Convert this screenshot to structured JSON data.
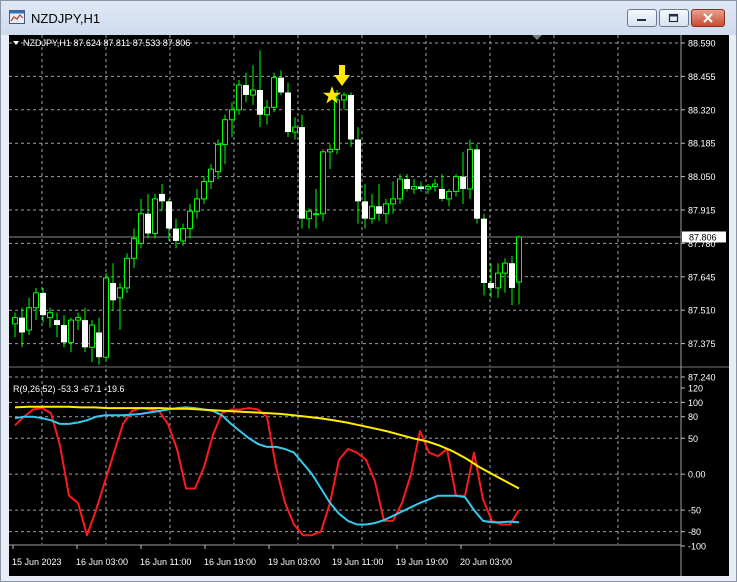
{
  "window": {
    "title": "NZDJPY,H1",
    "icons": {
      "app": "chart-window-icon",
      "minimize": "minimize-icon",
      "maximize": "maximize-icon",
      "close": "close-icon"
    }
  },
  "main_chart": {
    "header": "NZDJPY,H1  87.624 87.811 87.533 87.806",
    "price_ticks": [
      "88.590",
      "88.455",
      "88.320",
      "88.185",
      "88.050",
      "87.915",
      "87.780",
      "87.645",
      "87.510",
      "87.375",
      "87.240"
    ],
    "current_price_label": "87.806",
    "current_price": 87.806,
    "markers": {
      "star": "star-icon",
      "arrow": "arrow-down-icon"
    }
  },
  "indicator": {
    "header": "R(9,26,52) -53.3 -67.1 -19.6",
    "ticks": [
      "120",
      "100",
      "80",
      "50",
      "0.00",
      "-50",
      "-80",
      "-100"
    ]
  },
  "time_axis": {
    "labels": [
      "15 Jun 2023",
      "16 Jun 03:00",
      "16 Jun 11:00",
      "16 Jun 19:00",
      "19 Jun 03:00",
      "19 Jun 11:00",
      "19 Jun 19:00",
      "20 Jun 03:00"
    ]
  },
  "colors": {
    "candle": "#00ff00",
    "fast_line": "#ff1a1a",
    "mid_line": "#33ccee",
    "slow_line": "#ffee00",
    "marker": "#ffe800",
    "grid": "#9aa0a8"
  },
  "chart_data": {
    "type": "candlestick",
    "symbol": "NZDJPY",
    "timeframe": "H1",
    "ylim": [
      87.24,
      88.59
    ],
    "candles": [
      [
        87.455,
        87.5,
        87.4,
        87.48
      ],
      [
        87.48,
        87.52,
        87.36,
        87.42
      ],
      [
        87.43,
        87.56,
        87.41,
        87.52
      ],
      [
        87.52,
        87.6,
        87.47,
        87.58
      ],
      [
        87.58,
        87.6,
        87.46,
        87.49
      ],
      [
        87.48,
        87.52,
        87.44,
        87.5
      ],
      [
        87.47,
        87.5,
        87.4,
        87.45
      ],
      [
        87.45,
        87.49,
        87.36,
        87.38
      ],
      [
        87.38,
        87.48,
        87.34,
        87.47
      ],
      [
        87.47,
        87.5,
        87.43,
        87.48
      ],
      [
        87.47,
        87.52,
        87.34,
        87.36
      ],
      [
        87.36,
        87.47,
        87.3,
        87.45
      ],
      [
        87.42,
        87.48,
        87.29,
        87.32
      ],
      [
        87.32,
        87.66,
        87.3,
        87.64
      ],
      [
        87.62,
        87.7,
        87.51,
        87.55
      ],
      [
        87.56,
        87.62,
        87.43,
        87.6
      ],
      [
        87.6,
        87.74,
        87.58,
        87.72
      ],
      [
        87.72,
        87.84,
        87.68,
        87.8
      ],
      [
        87.78,
        87.96,
        87.76,
        87.9
      ],
      [
        87.9,
        87.98,
        87.8,
        87.82
      ],
      [
        87.82,
        87.98,
        87.8,
        87.96
      ],
      [
        87.98,
        88.02,
        87.91,
        87.95
      ],
      [
        87.95,
        87.96,
        87.79,
        87.84
      ],
      [
        87.84,
        87.88,
        87.76,
        87.79
      ],
      [
        87.79,
        87.86,
        87.77,
        87.84
      ],
      [
        87.84,
        87.94,
        87.8,
        87.91
      ],
      [
        87.91,
        88.0,
        87.88,
        87.96
      ],
      [
        87.96,
        88.05,
        87.94,
        88.03
      ],
      [
        88.03,
        88.1,
        88.0,
        88.08
      ],
      [
        88.07,
        88.2,
        88.04,
        88.18
      ],
      [
        88.18,
        88.3,
        88.1,
        88.28
      ],
      [
        88.28,
        88.35,
        88.21,
        88.32
      ],
      [
        88.32,
        88.44,
        88.3,
        88.42
      ],
      [
        88.42,
        88.47,
        88.35,
        88.38
      ],
      [
        88.38,
        88.5,
        88.34,
        88.4
      ],
      [
        88.4,
        88.56,
        88.25,
        88.3
      ],
      [
        88.3,
        88.36,
        88.26,
        88.33
      ],
      [
        88.33,
        88.47,
        88.31,
        88.45
      ],
      [
        88.45,
        88.48,
        88.38,
        88.39
      ],
      [
        88.39,
        88.43,
        88.21,
        88.23
      ],
      [
        88.23,
        88.29,
        88.2,
        88.25
      ],
      [
        88.25,
        88.3,
        87.84,
        87.88
      ],
      [
        87.88,
        87.92,
        87.84,
        87.91
      ],
      [
        87.9,
        88.0,
        87.84,
        87.9
      ],
      [
        87.9,
        88.16,
        87.87,
        88.15
      ],
      [
        88.15,
        88.18,
        88.08,
        88.16
      ],
      [
        88.16,
        88.4,
        88.14,
        88.36
      ],
      [
        88.36,
        88.39,
        88.32,
        88.38
      ],
      [
        88.38,
        88.39,
        88.17,
        88.2
      ],
      [
        88.2,
        88.25,
        87.86,
        87.95
      ],
      [
        87.95,
        88.02,
        87.84,
        87.88
      ],
      [
        87.88,
        87.98,
        87.86,
        87.93
      ],
      [
        87.93,
        88.02,
        87.87,
        87.9
      ],
      [
        87.9,
        87.96,
        87.86,
        87.94
      ],
      [
        87.94,
        88.03,
        87.9,
        87.96
      ],
      [
        87.96,
        88.06,
        87.94,
        88.04
      ],
      [
        88.04,
        88.06,
        87.99,
        88.0
      ],
      [
        88.0,
        88.04,
        87.98,
        88.01
      ],
      [
        88.01,
        88.03,
        87.99,
        88.0
      ],
      [
        88.0,
        88.02,
        87.98,
        88.01
      ],
      [
        88.01,
        88.04,
        87.99,
        88.02
      ],
      [
        88.0,
        88.06,
        87.95,
        87.96
      ],
      [
        87.96,
        88.0,
        87.93,
        87.99
      ],
      [
        87.99,
        88.06,
        87.97,
        88.05
      ],
      [
        88.05,
        88.15,
        87.94,
        88.0
      ],
      [
        88.0,
        88.2,
        87.96,
        88.16
      ],
      [
        88.16,
        88.18,
        87.86,
        87.88
      ],
      [
        87.88,
        87.9,
        87.57,
        87.62
      ],
      [
        87.62,
        87.7,
        87.56,
        87.6
      ],
      [
        87.6,
        87.7,
        87.56,
        87.66
      ],
      [
        87.66,
        87.72,
        87.58,
        87.7
      ],
      [
        87.7,
        87.73,
        87.53,
        87.6
      ],
      [
        87.624,
        87.811,
        87.533,
        87.806
      ]
    ],
    "oscillator": {
      "name": "R(9,26,52)",
      "ylim": [
        -100,
        120
      ],
      "last_values": [
        -53.3,
        -67.1,
        -19.6
      ],
      "series": [
        {
          "values": [
            68,
            80,
            90,
            92,
            85,
            40,
            -30,
            -40,
            -85,
            -50,
            -10,
            30,
            70,
            88,
            92,
            90,
            88,
            70,
            35,
            -20,
            -20,
            10,
            55,
            85,
            90,
            90,
            92,
            90,
            80,
            10,
            -40,
            -70,
            -85,
            -85,
            -80,
            -40,
            20,
            35,
            30,
            20,
            -10,
            -65,
            -65,
            -40,
            0,
            60,
            30,
            25,
            35,
            -30,
            -30,
            30,
            -35,
            -65,
            -70,
            -70,
            -50
          ]
        },
        {
          "values": [
            78,
            80,
            80,
            78,
            75,
            70,
            70,
            72,
            75,
            80,
            82,
            82,
            82,
            83,
            84,
            86,
            88,
            90,
            92,
            93,
            92,
            90,
            88,
            82,
            70,
            60,
            50,
            42,
            38,
            38,
            35,
            30,
            15,
            0,
            -20,
            -40,
            -55,
            -65,
            -70,
            -70,
            -68,
            -64,
            -58,
            -52,
            -46,
            -40,
            -35,
            -30,
            -30,
            -30,
            -32,
            -50,
            -65,
            -67,
            -67,
            -66,
            -67
          ]
        },
        {
          "values": [
            93,
            94,
            94,
            94,
            94,
            93,
            93,
            92,
            92,
            92,
            92,
            92,
            91,
            91,
            90,
            89,
            88,
            87,
            86,
            85,
            84,
            82,
            80,
            78,
            75,
            72,
            68,
            64,
            60,
            55,
            50,
            46,
            40,
            32,
            22,
            10,
            0,
            -10,
            -20
          ]
        }
      ]
    }
  }
}
